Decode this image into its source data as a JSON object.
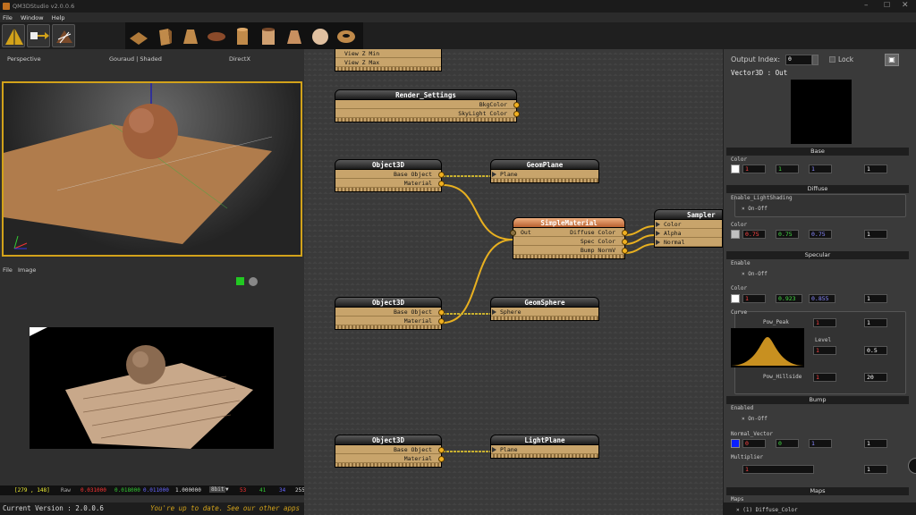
{
  "window": {
    "title": "QM3DStudio v2.0.0.6"
  },
  "menu": [
    "File",
    "Window",
    "Help"
  ],
  "viewport": {
    "view": "Perspective",
    "shading": "Gouraud | Shaded",
    "renderer": "DirectX"
  },
  "image_menu": [
    "File",
    "Image"
  ],
  "status": {
    "coords": "[279 , 148]",
    "raw_label": "Raw",
    "r": "0.031000",
    "g": "0.018000",
    "b": "0.011000",
    "a": "1.000000",
    "bit": "8bit",
    "v1": "53",
    "v2": "41",
    "v3": "34",
    "v4": "255"
  },
  "bottom": {
    "version": "Current Version : 2.0.0.6",
    "update": "You're up to date. See our other apps"
  },
  "nodes": {
    "viewrange": {
      "rows": [
        "View Z Min",
        "View Z Max"
      ]
    },
    "render": {
      "title": "Render_Settings",
      "rows": [
        "BkgColor",
        "SkyLight Color"
      ]
    },
    "obj1": {
      "title": "Object3D",
      "rows": [
        "Base Object",
        "Material"
      ]
    },
    "plane": {
      "title": "GeomPlane",
      "rows": [
        "Plane"
      ]
    },
    "mat": {
      "title": "SimpleMaterial",
      "out": "Out",
      "rows": [
        "Diffuse Color",
        "Spec   Color",
        "Bump NormV"
      ]
    },
    "sampler": {
      "title": "Sampler",
      "rows": [
        "Color",
        "Alpha",
        "Normal"
      ]
    },
    "obj2": {
      "title": "Object3D",
      "rows": [
        "Base Object",
        "Material"
      ]
    },
    "sphere": {
      "title": "GeomSphere",
      "rows": [
        "Sphere"
      ]
    },
    "obj3": {
      "title": "Object3D",
      "rows": [
        "Base Object",
        "Material"
      ]
    },
    "light": {
      "title": "LightPlane",
      "rows": [
        "Plane"
      ]
    }
  },
  "props": {
    "output_label": "Output Index:",
    "output_value": "0",
    "lock": "Lock",
    "vector": "Vector3D : Out",
    "sections": {
      "base": "Base",
      "diffuse": "Diffuse",
      "specular": "Specular",
      "bump": "Bump",
      "maps": "Maps"
    },
    "base_color_label": "Color",
    "base_color": [
      "1",
      "1",
      "1",
      "1"
    ],
    "enable_light": "Enable_LightShading",
    "onoff": "On-Off",
    "diffuse_color_label": "Color",
    "diffuse_color": [
      "0.75",
      "0.75",
      "0.75",
      "1"
    ],
    "enable": "Enable",
    "spec_color_label": "Color",
    "spec_color": [
      "1",
      "0.923",
      "0.855",
      "1"
    ],
    "curve": "Curve",
    "pow_peak": "Pow_Peak",
    "pow_peak_v": [
      "1",
      "1"
    ],
    "level": "Level",
    "level_v": [
      "1",
      "0.5"
    ],
    "pow_hill": "Pow_Hillside",
    "pow_hill_v": [
      "1",
      "20"
    ],
    "enabled": "Enabled",
    "normal_vector": "Normal_Vector",
    "normal_v": [
      "0",
      "0",
      "1",
      "1"
    ],
    "multiplier": "Multiplier",
    "multiplier_v": [
      "1",
      "1"
    ],
    "maps_label": "Maps",
    "maps_item": "(1) Diffuse_Color"
  },
  "colors": {
    "accent": "#d2a21a",
    "node_body": "#c8a46b",
    "wire": "#e8b020",
    "green": "#22c822"
  }
}
